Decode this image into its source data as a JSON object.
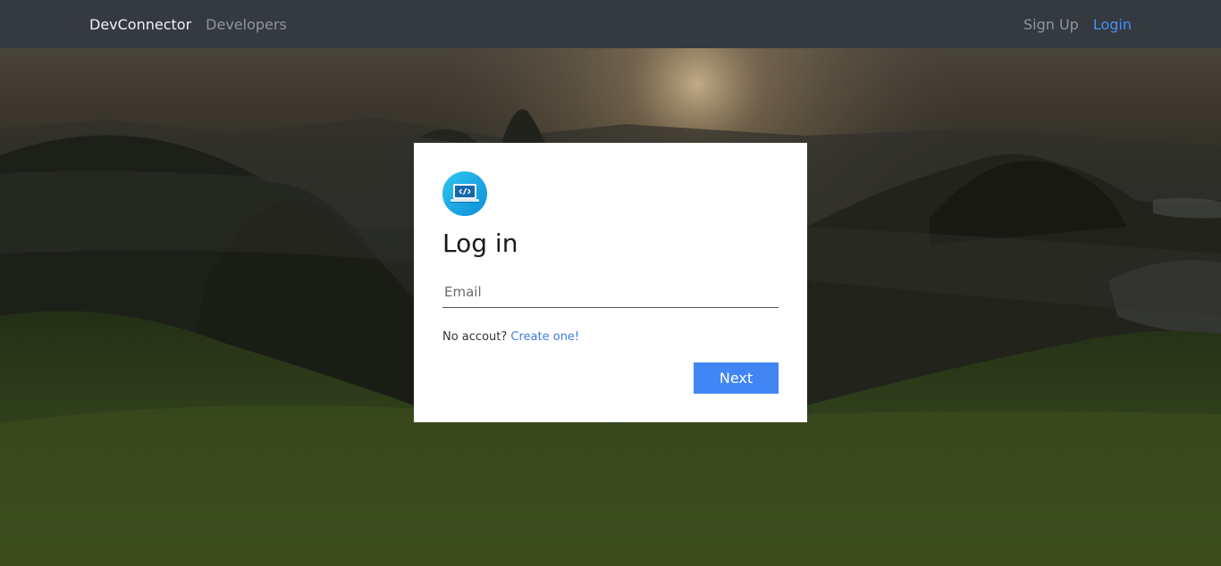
{
  "navbar": {
    "brand": "DevConnector",
    "developers": "Developers",
    "sign_up": "Sign Up",
    "login": "Login"
  },
  "login_card": {
    "logo_icon": "laptop-code-icon",
    "title": "Log in",
    "email_placeholder": "Email",
    "email_value": "",
    "no_account_text": "No accout?",
    "create_link": "Create one!",
    "next_button": "Next"
  },
  "colors": {
    "navbar_bg": "#343a40",
    "brand_text": "#f2f2f2",
    "active_link": "#4a8df5",
    "button": "#4285f4",
    "link": "#3d7fe0"
  }
}
